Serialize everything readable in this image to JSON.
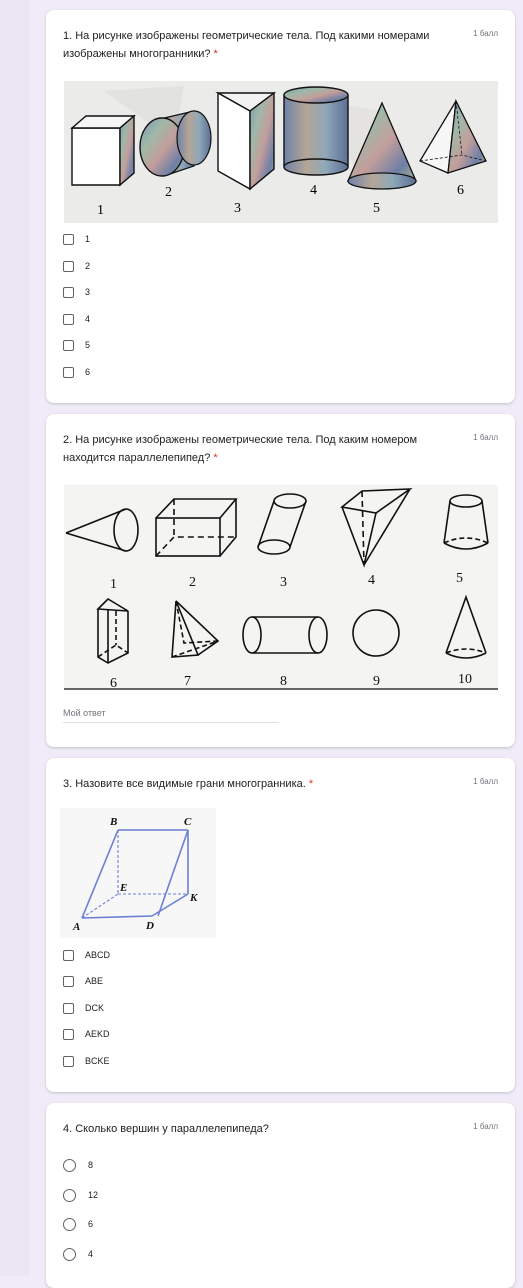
{
  "form": {
    "questions": [
      {
        "title": "1. На рисунке изображены геометрические тела. Под какими номерами изображены многогранники?",
        "required": "*",
        "points": "1 балл",
        "figure_labels": [
          "1",
          "2",
          "3",
          "4",
          "5",
          "6"
        ],
        "options": [
          "1",
          "2",
          "3",
          "4",
          "5",
          "6"
        ]
      },
      {
        "title": "2. На рисунке изображены геометрические тела. Под каким номером находится параллелепипед?",
        "required": "*",
        "points": "1 балл",
        "figure_labels": [
          "1",
          "2",
          "3",
          "4",
          "5",
          "6",
          "7",
          "8",
          "9",
          "10"
        ],
        "answer_placeholder": "Мой ответ"
      },
      {
        "title": "3. Назовите все видимые грани многогранника.",
        "required": "*",
        "points": "1 балл",
        "vertex_labels": [
          "B",
          "C",
          "E",
          "K",
          "A",
          "D"
        ],
        "options": [
          "ABCD",
          "ABE",
          "DCK",
          "AEKD",
          "BCKE"
        ]
      },
      {
        "title": "4. Сколько вершин у параллелепипеда?",
        "points": "1 балл",
        "options": [
          "8",
          "12",
          "6",
          "4"
        ]
      }
    ]
  }
}
